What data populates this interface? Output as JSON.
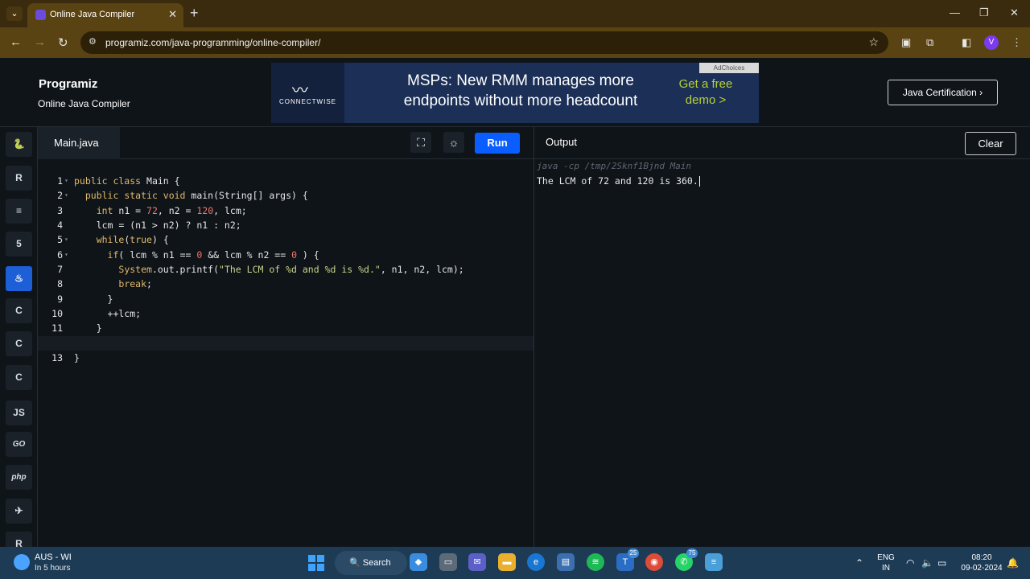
{
  "browser": {
    "tab_title": "Online Java Compiler",
    "url": "programiz.com/java-programming/online-compiler/",
    "profile_initial": "V"
  },
  "site": {
    "logo": "Programiz",
    "subtitle": "Online Java Compiler",
    "cert_button": "Java Certification ›"
  },
  "ad": {
    "brand": "CONNECTWISE",
    "headline": "MSPs: New RMM manages more endpoints without more headcount",
    "cta": "Get a free demo >",
    "choices": "AdChoices"
  },
  "languages": [
    {
      "name": "python",
      "icon": "python-icon",
      "label": "🐍"
    },
    {
      "name": "r",
      "icon": "r-icon",
      "label": "R"
    },
    {
      "name": "sql",
      "icon": "database-icon",
      "label": "≡"
    },
    {
      "name": "html",
      "icon": "html5-icon",
      "label": "5"
    },
    {
      "name": "java",
      "icon": "java-icon",
      "label": "♨"
    },
    {
      "name": "c",
      "icon": "c-icon",
      "label": "C"
    },
    {
      "name": "cpp",
      "icon": "cpp-icon",
      "label": "C"
    },
    {
      "name": "csharp",
      "icon": "csharp-icon",
      "label": "C"
    },
    {
      "name": "js",
      "icon": "js-icon",
      "label": "JS"
    },
    {
      "name": "go",
      "icon": "go-icon",
      "label": "GO"
    },
    {
      "name": "php",
      "icon": "php-icon",
      "label": "php"
    },
    {
      "name": "swift",
      "icon": "swift-icon",
      "label": "✈"
    },
    {
      "name": "rust",
      "icon": "rust-icon",
      "label": "R"
    }
  ],
  "editor": {
    "file_tab": "Main.java",
    "run_label": "Run",
    "lines": [
      "public class Main {",
      "  public static void main(String[] args) {",
      "    int n1 = 72, n2 = 120, lcm;",
      "    lcm = (n1 > n2) ? n1 : n2;",
      "    while(true) {",
      "      if( lcm % n1 == 0 && lcm % n2 == 0 ) {",
      "        System.out.printf(\"The LCM of %d and %d is %d.\", n1, n2, lcm);",
      "        break;",
      "      }",
      "      ++lcm;",
      "    }",
      "  }",
      "}"
    ],
    "current_line": 13
  },
  "output": {
    "title": "Output",
    "clear_label": "Clear",
    "command": "java -cp /tmp/2Sknf1Bjnd Main",
    "result": "The LCM of 72 and 120 is 360."
  },
  "taskbar": {
    "weather_title": "AUS - WI",
    "weather_sub": "In 5 hours",
    "search_label": "Search",
    "lang_line1": "ENG",
    "lang_line2": "IN",
    "time": "08:20",
    "date": "09-02-2024",
    "badge_teams": "25",
    "badge_whatsapp": "75"
  },
  "colors": {
    "accent_run": "#0a5eff",
    "active_lang": "#1d5fd6",
    "background": "#0f1419"
  }
}
